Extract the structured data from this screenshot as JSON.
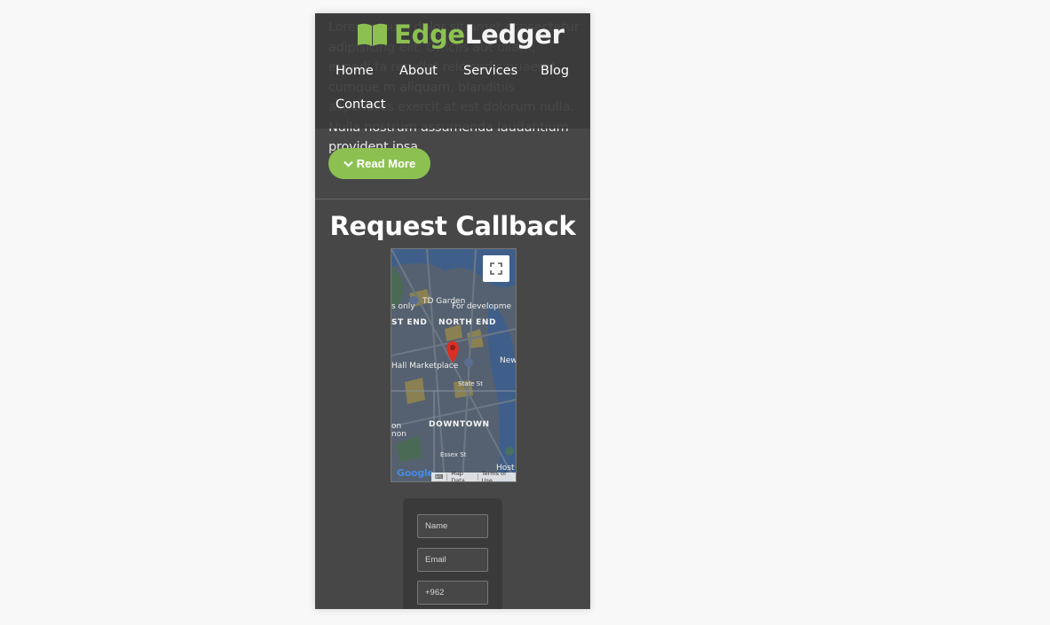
{
  "brand": {
    "part1": "Edge",
    "part2": "Ledger"
  },
  "intro": {
    "text": "Lorem ipsum dolor sit amet consectetur adipisicing elit. Officiis aut ullam, expedi ta repellat reiciendis quaerat cumque m aliquam, blanditiis asperiores exercit at est dolorum nulla. Nulla nostrum assumenda laudantium provident ipsa."
  },
  "nav": {
    "items": [
      "Home",
      "About",
      "Services",
      "Blog",
      "Contact"
    ]
  },
  "read_more": {
    "label": "Read More"
  },
  "callback": {
    "title": "Request Callback"
  },
  "map": {
    "labels": [
      "TD Garden",
      "s only",
      "For developme",
      "ST END",
      "NORTH END",
      "Hall Marketplace",
      "New",
      "State St",
      "DOWNTOWN",
      "on",
      "non",
      "Essex St",
      "Host"
    ],
    "logo": "Google",
    "map_data": "Map Data",
    "terms": "Terms of Use"
  },
  "form": {
    "name_placeholder": "Name",
    "email_placeholder": "Email",
    "phone_placeholder": "+962"
  },
  "colors": {
    "accent": "#8cc152",
    "background": "#474747",
    "header": "#3a3a3a"
  },
  "icons": {
    "logo": "open-book-icon",
    "read_more": "chevron-down-icon",
    "fullscreen": "fullscreen-icon",
    "pin": "map-pin-icon"
  }
}
